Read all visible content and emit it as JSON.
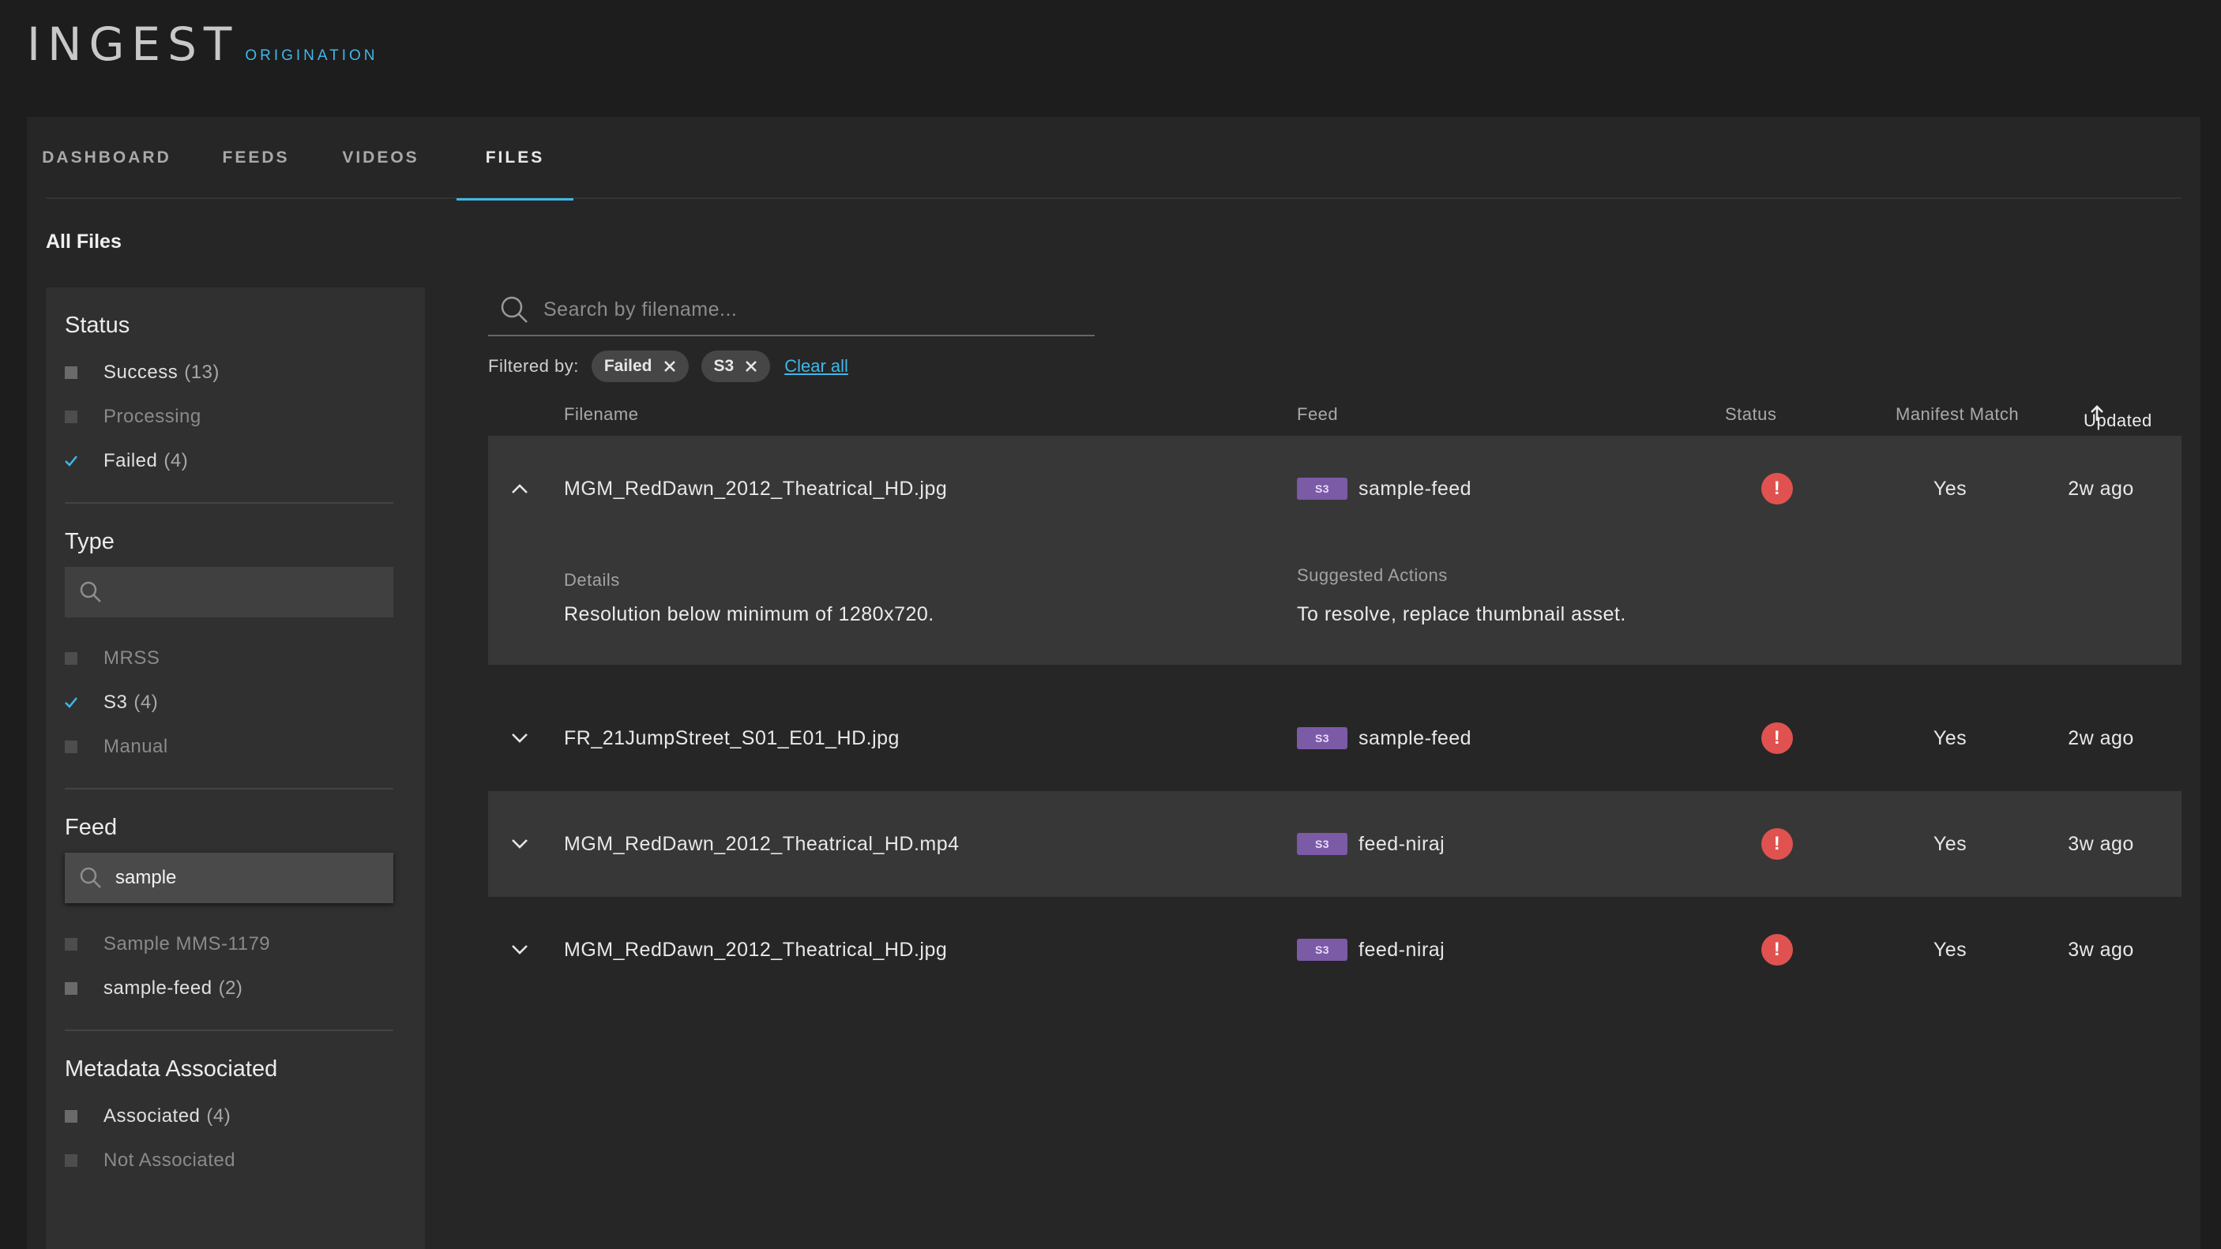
{
  "brand": {
    "title": "INGEST",
    "subtitle": "ORIGINATION"
  },
  "colors": {
    "accent": "#3fb8e8",
    "error": "#e0524f",
    "s3_badge": "#7b5aa6"
  },
  "tabs": [
    {
      "label": "DASHBOARD",
      "active": false
    },
    {
      "label": "FEEDS",
      "active": false
    },
    {
      "label": "VIDEOS",
      "active": false
    },
    {
      "label": "FILES",
      "active": true
    }
  ],
  "page_title": "All Files",
  "filters": {
    "status": {
      "heading": "Status",
      "options": [
        {
          "label": "Success",
          "count": "(13)",
          "checked": false
        },
        {
          "label": "Processing",
          "count": "",
          "checked": false,
          "dim": true
        },
        {
          "label": "Failed",
          "count": "(4)",
          "checked": true
        }
      ]
    },
    "type": {
      "heading": "Type",
      "search_value": "",
      "options": [
        {
          "label": "MRSS",
          "count": "",
          "checked": false,
          "dim": true
        },
        {
          "label": "S3",
          "count": "(4)",
          "checked": true
        },
        {
          "label": "Manual",
          "count": "",
          "checked": false,
          "dim": true
        }
      ]
    },
    "feed": {
      "heading": "Feed",
      "search_value": "sample",
      "options": [
        {
          "label": "Sample MMS-1179",
          "count": "",
          "checked": false,
          "dim": true
        },
        {
          "label": "sample-feed",
          "count": "(2)",
          "checked": false
        }
      ]
    },
    "metadata": {
      "heading": "Metadata Associated",
      "options": [
        {
          "label": "Associated",
          "count": "(4)",
          "checked": false
        },
        {
          "label": "Not Associated",
          "count": "",
          "checked": false,
          "dim": true
        }
      ]
    }
  },
  "search": {
    "placeholder": "Search by filename...",
    "value": ""
  },
  "filtered_by": {
    "label": "Filtered by:",
    "chips": [
      "Failed",
      "S3"
    ],
    "clear_label": "Clear all"
  },
  "table": {
    "headers": {
      "filename": "Filename",
      "feed": "Feed",
      "status": "Status",
      "manifest": "Manifest Match",
      "updated": "Updated"
    },
    "rows": [
      {
        "filename": "MGM_RedDawn_2012_Theatrical_HD.jpg",
        "badge": "S3",
        "feed": "sample-feed",
        "status": "error",
        "manifest": "Yes",
        "updated": "2w ago",
        "expanded": true,
        "details_label": "Details",
        "details_text": "Resolution below minimum of 1280x720.",
        "actions_label": "Suggested Actions",
        "actions_text": "To resolve, replace thumbnail asset."
      },
      {
        "filename": "FR_21JumpStreet_S01_E01_HD.jpg",
        "badge": "S3",
        "feed": "sample-feed",
        "status": "error",
        "manifest": "Yes",
        "updated": "2w ago"
      },
      {
        "filename": "MGM_RedDawn_2012_Theatrical_HD.mp4",
        "badge": "S3",
        "feed": "feed-niraj",
        "status": "error",
        "manifest": "Yes",
        "updated": "3w ago"
      },
      {
        "filename": "MGM_RedDawn_2012_Theatrical_HD.jpg",
        "badge": "S3",
        "feed": "feed-niraj",
        "status": "error",
        "manifest": "Yes",
        "updated": "3w ago"
      }
    ]
  }
}
